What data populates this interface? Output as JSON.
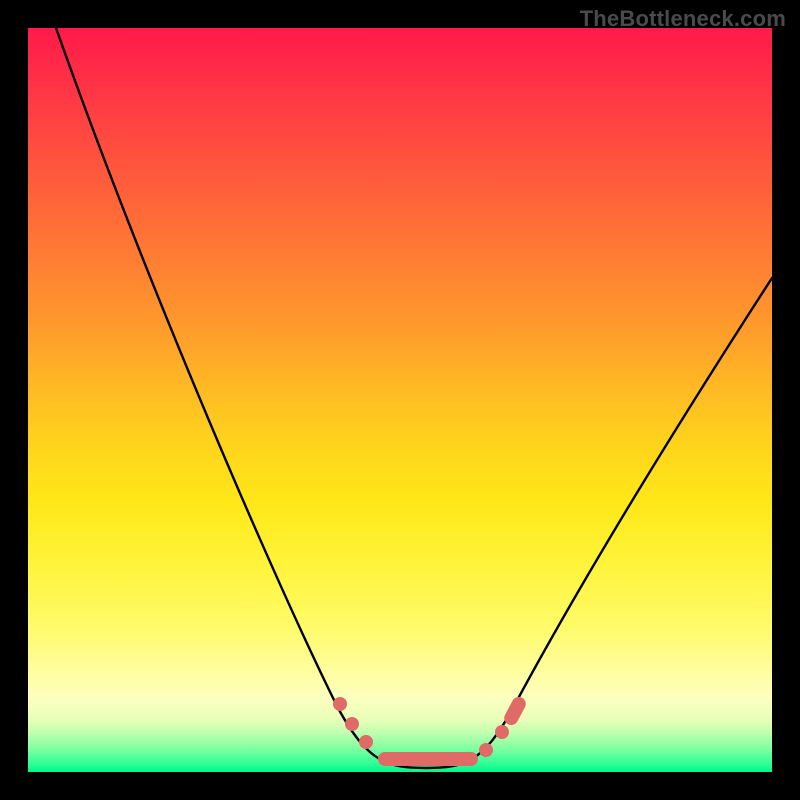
{
  "watermark": "TheBottleneck.com",
  "chart_data": {
    "type": "line",
    "title": "",
    "xlabel": "",
    "ylabel": "",
    "xlim": [
      0,
      100
    ],
    "ylim": [
      0,
      100
    ],
    "grid": false,
    "legend": false,
    "series": [
      {
        "name": "bottleneck-curve",
        "x": [
          2,
          6,
          10,
          15,
          20,
          25,
          30,
          35,
          40,
          43,
          45,
          48,
          50,
          53,
          55,
          58,
          60,
          63,
          67,
          72,
          78,
          85,
          92,
          100
        ],
        "values": [
          100,
          88,
          77,
          65,
          54,
          43,
          33,
          24,
          15,
          10,
          7,
          4,
          2,
          1,
          1,
          2,
          4,
          7,
          12,
          20,
          30,
          42,
          55,
          70
        ]
      }
    ],
    "markers": {
      "name": "bottleneck-range",
      "approximate": true,
      "x": [
        43,
        45,
        47,
        49,
        51,
        53,
        55,
        57,
        60,
        63,
        65
      ],
      "values": [
        9,
        6,
        4,
        2,
        1,
        1,
        1,
        2,
        4,
        7,
        9
      ]
    }
  }
}
